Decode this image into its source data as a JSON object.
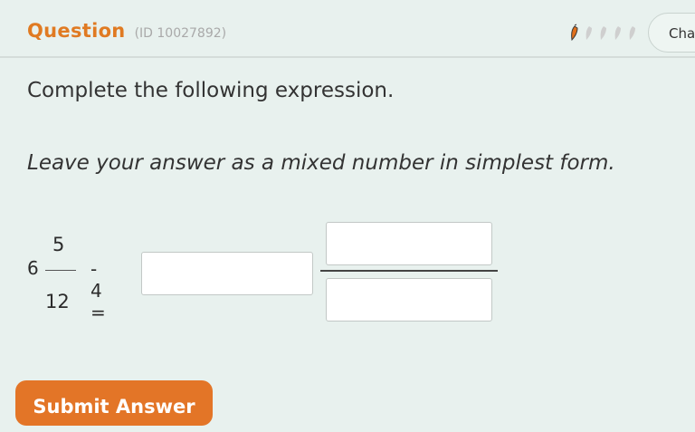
{
  "header": {
    "title": "Question",
    "question_id": "(ID 10027892)",
    "change_label": "Cha",
    "difficulty": {
      "filled": 1,
      "total": 5,
      "icon": "pepper-icon",
      "filled_color": "#e0701c",
      "empty_color": "#c9c9c9"
    }
  },
  "question": {
    "instruction": "Complete the following expression.",
    "note": "Leave your answer as a mixed number in simplest form.",
    "expression": {
      "whole": "6",
      "numerator": "5",
      "denominator": "12",
      "operation": "- 4 ="
    },
    "answer": {
      "whole": "",
      "numerator": "",
      "denominator": ""
    }
  },
  "actions": {
    "submit_label": "Submit Answer"
  },
  "colors": {
    "accent": "#e37527",
    "background": "#e8f1ee"
  }
}
